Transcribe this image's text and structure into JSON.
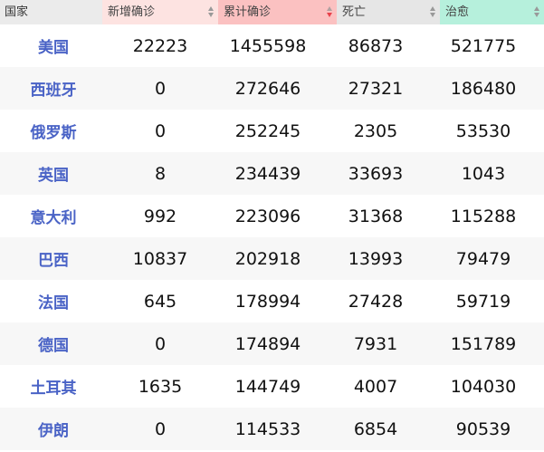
{
  "header": {
    "country": "国家",
    "new_confirmed": "新增确诊",
    "total_confirmed": "累计确诊",
    "deaths": "死亡",
    "cured": "治愈"
  },
  "rows": [
    {
      "country": "美国",
      "new": "22223",
      "total": "1455598",
      "death": "86873",
      "cured": "521775"
    },
    {
      "country": "西班牙",
      "new": "0",
      "total": "272646",
      "death": "27321",
      "cured": "186480"
    },
    {
      "country": "俄罗斯",
      "new": "0",
      "total": "252245",
      "death": "2305",
      "cured": "53530"
    },
    {
      "country": "英国",
      "new": "8",
      "total": "234439",
      "death": "33693",
      "cured": "1043"
    },
    {
      "country": "意大利",
      "new": "992",
      "total": "223096",
      "death": "31368",
      "cured": "115288"
    },
    {
      "country": "巴西",
      "new": "10837",
      "total": "202918",
      "death": "13993",
      "cured": "79479"
    },
    {
      "country": "法国",
      "new": "645",
      "total": "178994",
      "death": "27428",
      "cured": "59719"
    },
    {
      "country": "德国",
      "new": "0",
      "total": "174894",
      "death": "7931",
      "cured": "151789"
    },
    {
      "country": "土耳其",
      "new": "1635",
      "total": "144749",
      "death": "4007",
      "cured": "104030"
    },
    {
      "country": "伊朗",
      "new": "0",
      "total": "114533",
      "death": "6854",
      "cured": "90539"
    }
  ],
  "sort": {
    "column": "total_confirmed",
    "direction": "descending"
  },
  "colors": {
    "country_link": "#4a63c6",
    "header_new": "#fde3e1",
    "header_total": "#fbc1c1",
    "header_death": "#e6e6e6",
    "header_cured": "#b6f0dc",
    "sort_active": "#e8414b"
  },
  "icons": [
    "sort-icon"
  ]
}
